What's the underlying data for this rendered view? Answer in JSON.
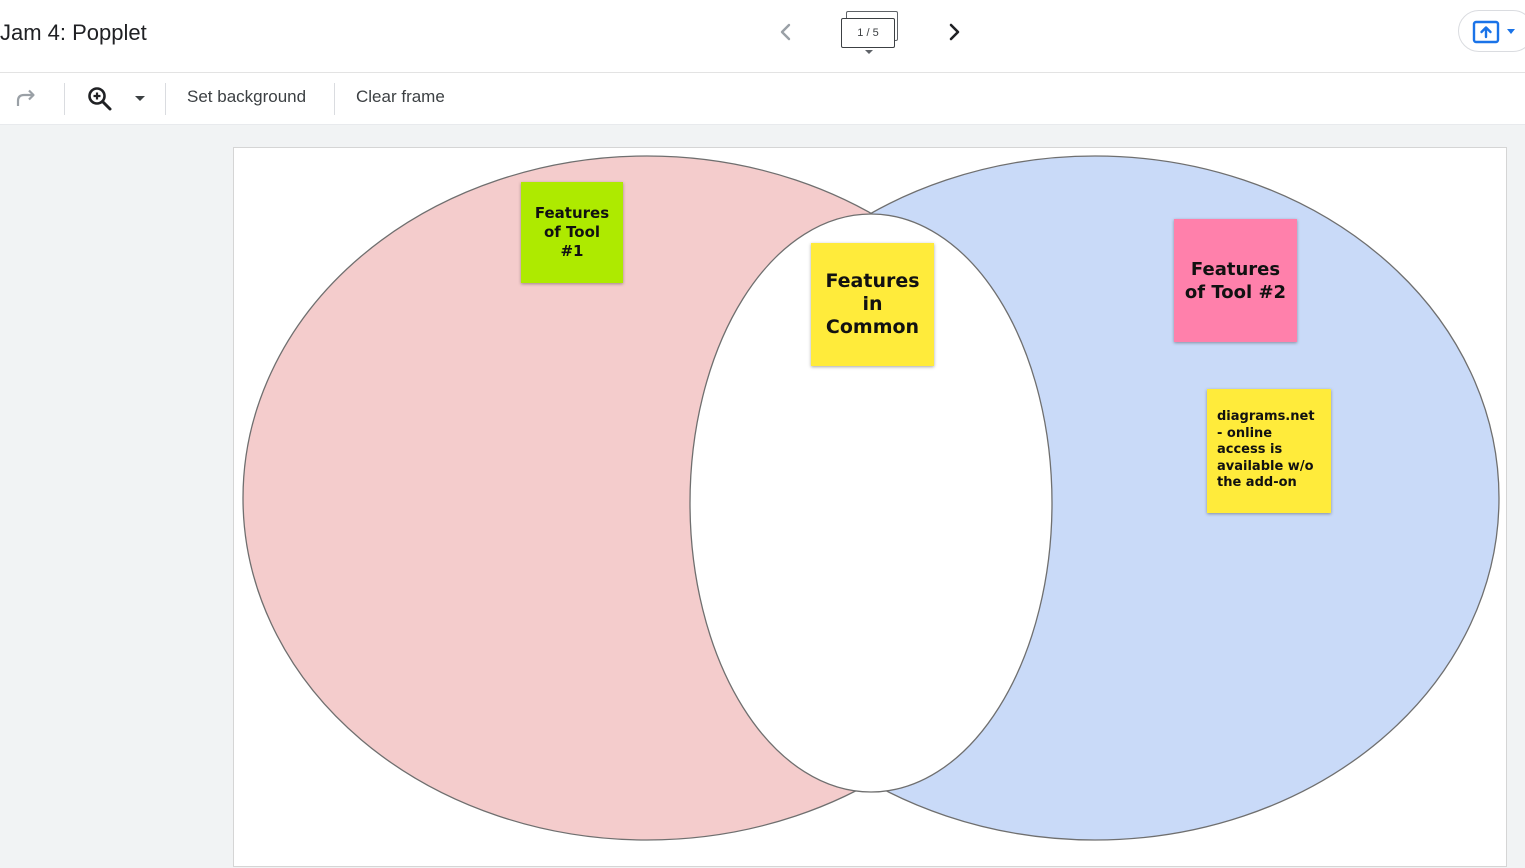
{
  "header": {
    "title": "Jam 4: Popplet",
    "frame_counter": "1 / 5"
  },
  "icons": {
    "prev": "chevron-left-icon",
    "next": "chevron-right-icon",
    "frames": "frames-stack-icon",
    "share": "upload-share-icon",
    "redo": "redo-icon",
    "zoom": "zoom-in-icon"
  },
  "toolbar": {
    "set_background_label": "Set background",
    "clear_frame_label": "Clear frame"
  },
  "venn": {
    "left_circle_color": "#f4cccc",
    "right_circle_color": "#c9daf8",
    "overlap_color": "#ffffff"
  },
  "notes": [
    {
      "text": "Features of Tool #1",
      "color": "#aeea00"
    },
    {
      "text": "Features in Common",
      "color": "#ffeb3b"
    },
    {
      "text": "Features of Tool #2",
      "color": "#ff80ab"
    },
    {
      "text": "diagrams.net - online access is available w/o the add-on",
      "color": "#ffeb3b"
    }
  ],
  "colors": {
    "accent": "#1a73e8"
  }
}
